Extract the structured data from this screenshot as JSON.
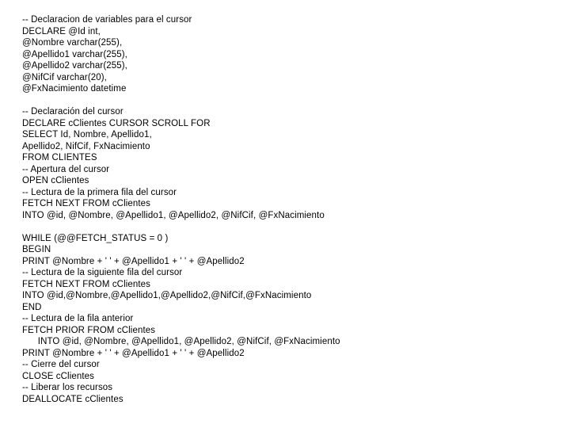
{
  "code": {
    "lines": [
      "-- Declaracion de variables para el cursor",
      "DECLARE @Id int,",
      "@Nombre varchar(255),",
      "@Apellido1 varchar(255),",
      "@Apellido2 varchar(255),",
      "@NifCif varchar(20),",
      "@FxNacimiento datetime",
      "",
      "-- Declaración del cursor",
      "DECLARE cClientes CURSOR SCROLL FOR",
      "SELECT Id, Nombre, Apellido1,",
      "Apellido2, NifCif, FxNacimiento",
      "FROM CLIENTES",
      "-- Apertura del cursor",
      "OPEN cClientes",
      "-- Lectura de la primera fila del cursor",
      "FETCH NEXT FROM cClientes",
      "INTO @id, @Nombre, @Apellido1, @Apellido2, @NifCif, @FxNacimiento",
      "",
      "WHILE (@@FETCH_STATUS = 0 )",
      "BEGIN",
      "PRINT @Nombre + ' ' + @Apellido1 + ' ' + @Apellido2",
      "-- Lectura de la siguiente fila del cursor",
      "FETCH NEXT FROM cClientes",
      "INTO @id,@Nombre,@Apellido1,@Apellido2,@NifCif,@FxNacimiento",
      "END",
      "-- Lectura de la fila anterior",
      "FETCH PRIOR FROM cClientes",
      "      INTO @id, @Nombre, @Apellido1, @Apellido2, @NifCif, @FxNacimiento",
      "PRINT @Nombre + ' ' + @Apellido1 + ' ' + @Apellido2",
      "-- Cierre del cursor",
      "CLOSE cClientes",
      "-- Liberar los recursos",
      "DEALLOCATE cClientes"
    ]
  }
}
